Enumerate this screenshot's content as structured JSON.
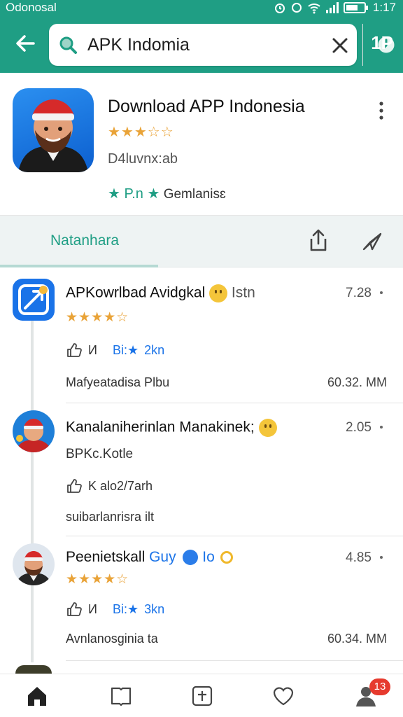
{
  "status_bar": {
    "carrier": "Odonosal",
    "time": "1:17"
  },
  "search": {
    "query": "APK Indomia"
  },
  "header_extra": "1P",
  "app": {
    "title": "Download APP Indonesia",
    "rating_stars": "★★★☆☆",
    "subtitle": "D4luvnx:ab",
    "tag_prefix": "★ P.n ★",
    "tag_text": "Gemlanisɛ"
  },
  "tab": {
    "label": "Natanhara"
  },
  "items": [
    {
      "title": "APKowrlbad Avidgkal",
      "title_suffix": "Istn",
      "number": "7.28",
      "stars": "★★★★☆",
      "meta_count": "И",
      "meta_label": "Bi:★",
      "meta_value": "2kn",
      "footer": "Mafyeatadisa Plbu",
      "size": "60.32. MM"
    },
    {
      "title": "Kanalaniherinlan Manakinek;",
      "number": "2.05",
      "subtitle": "BPKc.Kotle",
      "meta_text": "K alo2/7arh",
      "footer": "suibarlanrisra ilt"
    },
    {
      "title": "Peenietskall",
      "title_accent": "Guy",
      "title_suffix": "Io",
      "number": "4.85",
      "stars": "★★★★☆",
      "meta_count": "И",
      "meta_label": "Bi:★",
      "meta_value": "3kn",
      "footer": "Avnlanosginia ta",
      "size": "60.34. MM"
    }
  ],
  "bottom_nav": {
    "badge": "13"
  },
  "colors": {
    "brand": "#1f9e84",
    "star": "#e9a338",
    "link_blue": "#1a73e8",
    "badge": "#e63a2e"
  }
}
